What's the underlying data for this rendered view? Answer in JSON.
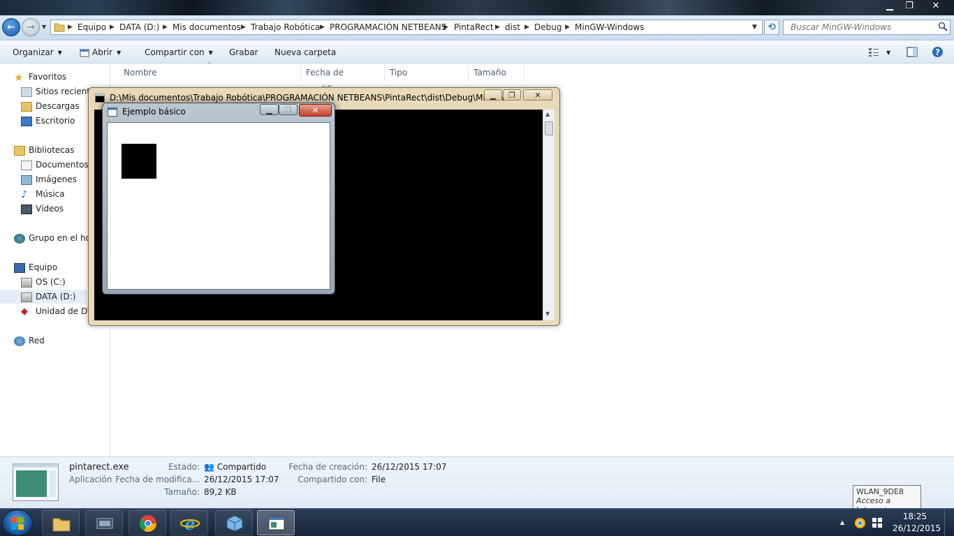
{
  "window": {
    "controls": {
      "minimize": "▁",
      "restore": "❐",
      "close": "✕"
    }
  },
  "address": {
    "back_glyph": "←",
    "forward_glyph": "→",
    "path": [
      "Equipo",
      "DATA (D:)",
      "Mis documentos",
      "Trabajo Robótica",
      "PROGRAMACIÓN NETBEANS",
      "PintaRect",
      "dist",
      "Debug",
      "MinGW-Windows"
    ],
    "search_placeholder": "Buscar MinGW-Windows",
    "refresh_glyph": "⟲"
  },
  "commands": {
    "organize": "Organizar",
    "open": "Abrir",
    "share": "Compartir con",
    "burn": "Grabar",
    "new_folder": "Nueva carpeta"
  },
  "nav": {
    "favorites": "Favoritos",
    "recent": "Sitios recientes",
    "downloads": "Descargas",
    "desktop": "Escritorio",
    "libraries": "Bibliotecas",
    "documents": "Documentos",
    "images": "Imágenes",
    "music": "Música",
    "videos": "Vídeos",
    "homegroup": "Grupo en el hogar",
    "computer": "Equipo",
    "drive_c": "OS (C:)",
    "drive_d": "DATA (D:)",
    "dvd": "Unidad de DVD",
    "network": "Red"
  },
  "columns": {
    "name": "Nombre",
    "modified": "Fecha de modifica...",
    "type": "Tipo",
    "size": "Tamaño"
  },
  "console": {
    "title": "D:\\Mis documentos\\Trabajo Robótica\\PROGRAMACIÓN NETBEANS\\PintaRect\\dist\\Debug\\MinGW...",
    "min": "▁",
    "max": "❐",
    "close": "✕"
  },
  "example": {
    "title": "Ejemplo básico",
    "min": "▁",
    "max": "❐",
    "close": "✕"
  },
  "details": {
    "filename": "pintarect.exe",
    "filetype": "Aplicación",
    "state_label": "Estado:",
    "state_value": "Compartido",
    "modified_label": "Fecha de modifica...",
    "modified_value": "26/12/2015 17:07",
    "size_label": "Tamaño:",
    "size_value": "89,2 KB",
    "created_label": "Fecha de creación:",
    "created_value": "26/12/2015 17:07",
    "shared_label": "Compartido con:",
    "shared_value": "File"
  },
  "tooltip": {
    "line1": "WLAN_9DE8",
    "line2": "Acceso a Internet"
  },
  "taskbar": {
    "time": "18:25",
    "date": "26/12/2015",
    "tray_arrow": "▲"
  }
}
